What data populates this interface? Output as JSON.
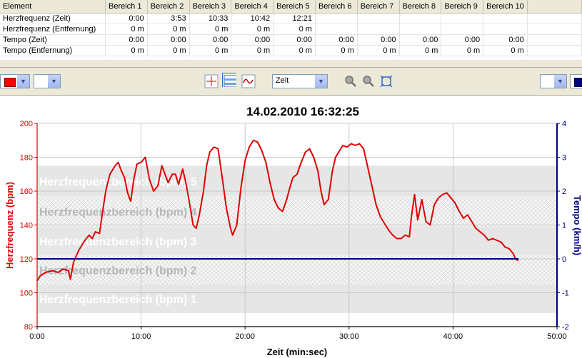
{
  "table": {
    "headers": [
      "Element",
      "Bereich 1",
      "Bereich 2",
      "Bereich 3",
      "Bereich 4",
      "Bereich 5",
      "Bereich 6",
      "Bereich 7",
      "Bereich 8",
      "Bereich 9",
      "Bereich 10"
    ],
    "rows": [
      [
        "Herzfrequenz (Zeit)",
        "0:00",
        "3:53",
        "10:33",
        "10:42",
        "12:21",
        "",
        "",
        "",
        "",
        ""
      ],
      [
        "Herzfrequenz (Entfernung)",
        "0 m",
        "0 m",
        "0 m",
        "0 m",
        "0 m",
        "",
        "",
        "",
        "",
        ""
      ],
      [
        "Tempo (Zeit)",
        "0:00",
        "0:00",
        "0:00",
        "0:00",
        "0:00",
        "0:00",
        "0:00",
        "0:00",
        "0:00",
        "0:00"
      ],
      [
        "Tempo (Entfernung)",
        "0 m",
        "0 m",
        "0 m",
        "0 m",
        "0 m",
        "0 m",
        "0 m",
        "0 m",
        "0 m",
        "0 m"
      ]
    ]
  },
  "toolbar": {
    "axis_select": "Zeit",
    "color_left": "#ff0000",
    "color_right": "#000080",
    "icons": [
      "crosshair-icon",
      "zones-icon",
      "curve-icon",
      "zoom-in-icon",
      "zoom-out-icon",
      "zoom-fit-icon"
    ]
  },
  "chart_data": {
    "type": "line",
    "title": "14.02.2010 16:32:25",
    "xlabel": "Zeit (min:sec)",
    "ylabel_left": "Herzfrequenz (bpm)",
    "ylabel_right": "Tempo (km/h)",
    "xlim": [
      0,
      50
    ],
    "ylim_left": [
      80,
      200
    ],
    "ylim_right": [
      -2,
      4
    ],
    "x_ticks": [
      0,
      10,
      20,
      30,
      40,
      50
    ],
    "x_tick_labels": [
      "0:00",
      "10:00",
      "20:00",
      "30:00",
      "40:00",
      "50:00"
    ],
    "y_ticks_left": [
      80,
      100,
      120,
      140,
      160,
      180,
      200
    ],
    "y_ticks_right": [
      -2,
      -1,
      0,
      1,
      2,
      3,
      4
    ],
    "grid": true,
    "zones": [
      {
        "label": "Herzfrequenzbereich (bpm) 1",
        "min": 88,
        "max": 105
      },
      {
        "label": "Herzfrequenzbereich (bpm) 2",
        "min": 105,
        "max": 122
      },
      {
        "label": "Herzfrequenzbereich (bpm) 3",
        "min": 122,
        "max": 139
      },
      {
        "label": "Herzfrequenzbereich (bpm) 4",
        "min": 139,
        "max": 157
      },
      {
        "label": "Herzfrequenzbereich (bpm) 5",
        "min": 157,
        "max": 175
      }
    ],
    "series": [
      {
        "color": "#e00000",
        "axis": "left",
        "x": [
          0,
          0.3,
          0.8,
          1.5,
          2.0,
          2.5,
          3.0,
          3.2,
          3.5,
          4.0,
          4.3,
          4.6,
          5.0,
          5.3,
          5.6,
          6.0,
          6.3,
          6.6,
          7.0,
          7.5,
          7.8,
          8.1,
          8.4,
          8.7,
          9.0,
          9.3,
          9.6,
          10.0,
          10.4,
          10.8,
          11.2,
          11.6,
          12.0,
          12.3,
          12.6,
          13.0,
          13.3,
          13.6,
          14.0,
          14.3,
          14.6,
          15.0,
          15.3,
          15.6,
          16.0,
          16.3,
          16.6,
          17.0,
          17.4,
          17.8,
          18.2,
          18.6,
          18.8,
          19.2,
          19.6,
          20.0,
          20.4,
          20.8,
          21.2,
          21.6,
          22.0,
          22.4,
          22.8,
          23.2,
          23.6,
          24.0,
          24.3,
          24.6,
          25.0,
          25.4,
          25.8,
          26.2,
          26.6,
          27.0,
          27.3,
          27.6,
          28.0,
          28.4,
          28.7,
          29.0,
          29.4,
          29.8,
          30.2,
          30.6,
          31.0,
          31.4,
          31.8,
          32.2,
          32.6,
          33.0,
          33.4,
          33.8,
          34.2,
          34.6,
          35.0,
          35.4,
          35.8,
          36.0,
          36.3,
          36.6,
          37.0,
          37.4,
          37.8,
          38.2,
          38.6,
          39.0,
          39.4,
          39.8,
          40.2,
          40.6,
          41.0,
          41.4,
          41.8,
          42.2,
          42.6,
          43.0,
          43.4,
          43.8,
          44.2,
          44.6,
          45.0,
          45.4,
          45.8,
          46.0,
          46.3
        ],
        "y": [
          107,
          110,
          112,
          113,
          112,
          114,
          113,
          108,
          118,
          125,
          128,
          131,
          134,
          132,
          136,
          135,
          148,
          160,
          170,
          175,
          177,
          172,
          168,
          159,
          154,
          167,
          176,
          177,
          180,
          167,
          160,
          163,
          175,
          170,
          165,
          170,
          170,
          164,
          173,
          165,
          155,
          140,
          138,
          146,
          160,
          175,
          183,
          186,
          185,
          168,
          150,
          138,
          134,
          140,
          162,
          178,
          186,
          190,
          189,
          184,
          177,
          165,
          155,
          150,
          148,
          155,
          162,
          168,
          170,
          177,
          183,
          185,
          180,
          172,
          160,
          152,
          155,
          172,
          180,
          183,
          187,
          186,
          188,
          187,
          188,
          185,
          174,
          163,
          152,
          145,
          141,
          137,
          134,
          132,
          132,
          134,
          133,
          145,
          158,
          143,
          155,
          142,
          140,
          152,
          156,
          158,
          159,
          156,
          153,
          148,
          144,
          146,
          142,
          138,
          136,
          134,
          131,
          132,
          131,
          130,
          127,
          126,
          123,
          120,
          119
        ]
      },
      {
        "color": "#000080",
        "axis": "right",
        "x": [
          0,
          46.3
        ],
        "y": [
          0,
          0
        ]
      }
    ]
  }
}
